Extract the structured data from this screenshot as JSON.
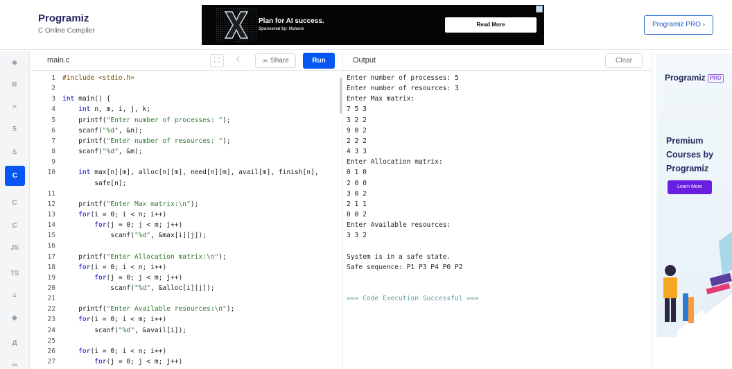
{
  "header": {
    "logo_text": "Programiz",
    "logo_sub": "C Online Compiler",
    "ad": {
      "title": "Plan for AI success.",
      "sponsor": "Sponsored by: Nutanix",
      "button": "Read More"
    },
    "pro_button": "Programiz PRO ›"
  },
  "sidebar": {
    "items": [
      {
        "name": "python-icon",
        "glyph": "❖"
      },
      {
        "name": "r-icon",
        "glyph": "R"
      },
      {
        "name": "sql-icon",
        "glyph": "≡"
      },
      {
        "name": "html-icon",
        "glyph": "5"
      },
      {
        "name": "java-icon",
        "glyph": "♨"
      },
      {
        "name": "c-icon",
        "glyph": "C",
        "active": true
      },
      {
        "name": "cpp-icon",
        "glyph": "C"
      },
      {
        "name": "csharp-icon",
        "glyph": "C"
      },
      {
        "name": "js-icon",
        "glyph": "JS"
      },
      {
        "name": "ts-icon",
        "glyph": "TS"
      },
      {
        "name": "go-icon",
        "glyph": "≡"
      },
      {
        "name": "swift-icon",
        "glyph": "◆"
      },
      {
        "name": "rust-icon",
        "glyph": "Д"
      },
      {
        "name": "php-icon",
        "glyph": "∞"
      }
    ]
  },
  "editor": {
    "tab": "main.c",
    "share": "⫘ Share",
    "run": "Run",
    "lines": [
      {
        "n": "1",
        "code": "#include <stdio.h>"
      },
      {
        "n": "2",
        "code": ""
      },
      {
        "n": "3",
        "code": "int main() {"
      },
      {
        "n": "4",
        "code": "    int n, m, i, j, k;"
      },
      {
        "n": "5",
        "code": "    printf(\"Enter number of processes: \");"
      },
      {
        "n": "6",
        "code": "    scanf(\"%d\", &n);"
      },
      {
        "n": "7",
        "code": "    printf(\"Enter number of resources: \");"
      },
      {
        "n": "8",
        "code": "    scanf(\"%d\", &m);"
      },
      {
        "n": "9",
        "code": ""
      },
      {
        "n": "10",
        "code": "    int max[n][m], alloc[n][m], need[n][m], avail[m], finish[n],"
      },
      {
        "n": "",
        "code": "        safe[n];"
      },
      {
        "n": "11",
        "code": ""
      },
      {
        "n": "12",
        "code": "    printf(\"Enter Max matrix:\\n\");"
      },
      {
        "n": "13",
        "code": "    for(i = 0; i < n; i++)"
      },
      {
        "n": "14",
        "code": "        for(j = 0; j < m; j++)"
      },
      {
        "n": "15",
        "code": "            scanf(\"%d\", &max[i][j]);"
      },
      {
        "n": "16",
        "code": ""
      },
      {
        "n": "17",
        "code": "    printf(\"Enter Allocation matrix:\\n\");"
      },
      {
        "n": "18",
        "code": "    for(i = 0; i < n; i++)"
      },
      {
        "n": "19",
        "code": "        for(j = 0; j < m; j++)"
      },
      {
        "n": "20",
        "code": "            scanf(\"%d\", &alloc[i][j]);"
      },
      {
        "n": "21",
        "code": ""
      },
      {
        "n": "22",
        "code": "    printf(\"Enter Available resources:\\n\");"
      },
      {
        "n": "23",
        "code": "    for(i = 0; i < m; i++)"
      },
      {
        "n": "24",
        "code": "        scanf(\"%d\", &avail[i]);"
      },
      {
        "n": "25",
        "code": ""
      },
      {
        "n": "26",
        "code": "    for(i = 0; i < n; i++)"
      },
      {
        "n": "27",
        "code": "        for(j = 0; j < m; j++)"
      }
    ]
  },
  "output": {
    "title": "Output",
    "clear": "Clear",
    "lines": [
      "Enter number of processes: 5",
      "Enter number of resources: 3",
      "Enter Max matrix:",
      "7 5 3",
      "3 2 2",
      "9 0 2",
      "2 2 2",
      "4 3 3",
      "Enter Allocation matrix:",
      "0 1 0",
      "2 0 0",
      "3 0 2",
      "2 1 1",
      "0 0 2",
      "Enter Available resources:",
      "3 3 2",
      "",
      "System is in a safe state.",
      "Safe sequence: P1 P3 P4 P0 P2",
      "",
      "",
      "=== Code Execution Successful ==="
    ]
  },
  "right_ad": {
    "logo": "Programiz",
    "pro_badge": "PRO",
    "headline": "Premium Courses by Programiz",
    "button": "Learn More"
  }
}
